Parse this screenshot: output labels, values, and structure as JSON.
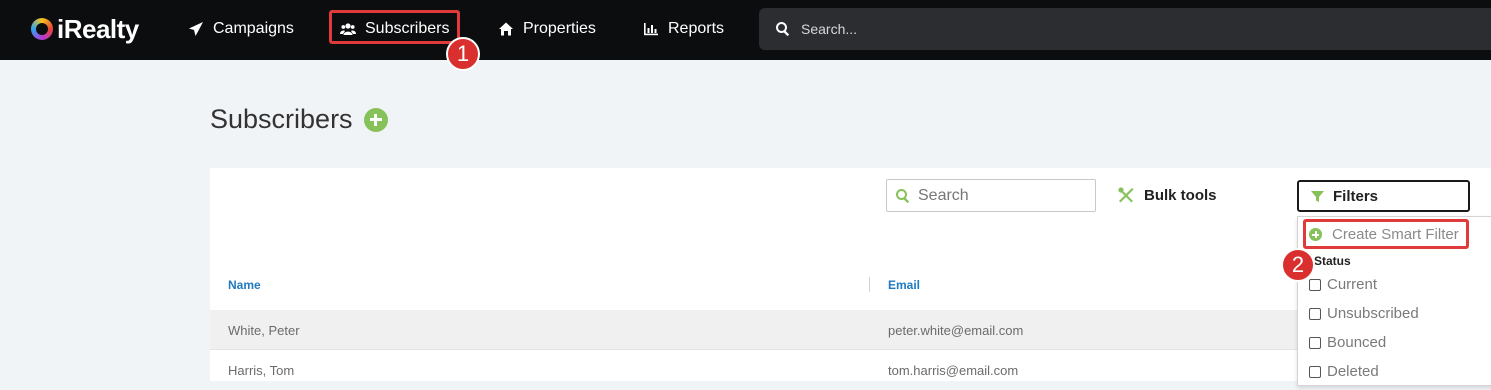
{
  "app": {
    "name": "iRealty"
  },
  "nav": {
    "items": [
      {
        "label": "Campaigns",
        "icon": "paper-plane-icon"
      },
      {
        "label": "Subscribers",
        "icon": "users-icon"
      },
      {
        "label": "Properties",
        "icon": "home-icon"
      },
      {
        "label": "Reports",
        "icon": "bar-chart-icon"
      }
    ],
    "search_placeholder": "Search..."
  },
  "callouts": {
    "one": "1",
    "two": "2"
  },
  "page": {
    "title": "Subscribers"
  },
  "toolbar": {
    "search_placeholder": "Search",
    "bulk_tools": "Bulk tools",
    "filters": "Filters"
  },
  "table": {
    "columns": [
      "Name",
      "Email"
    ],
    "rows": [
      {
        "name": "White, Peter",
        "email": "peter.white@email.com"
      },
      {
        "name": "Harris, Tom",
        "email": "tom.harris@email.com"
      }
    ]
  },
  "filter_menu": {
    "create_smart_filter": "Create Smart Filter",
    "status_heading": "Status",
    "options": [
      "Current",
      "Unsubscribed",
      "Bounced",
      "Deleted"
    ]
  },
  "colors": {
    "accent_green": "#87c15a",
    "highlight_red": "#e03a3a",
    "link_blue": "#1e7ac2",
    "topbar": "#0c0d0f"
  }
}
